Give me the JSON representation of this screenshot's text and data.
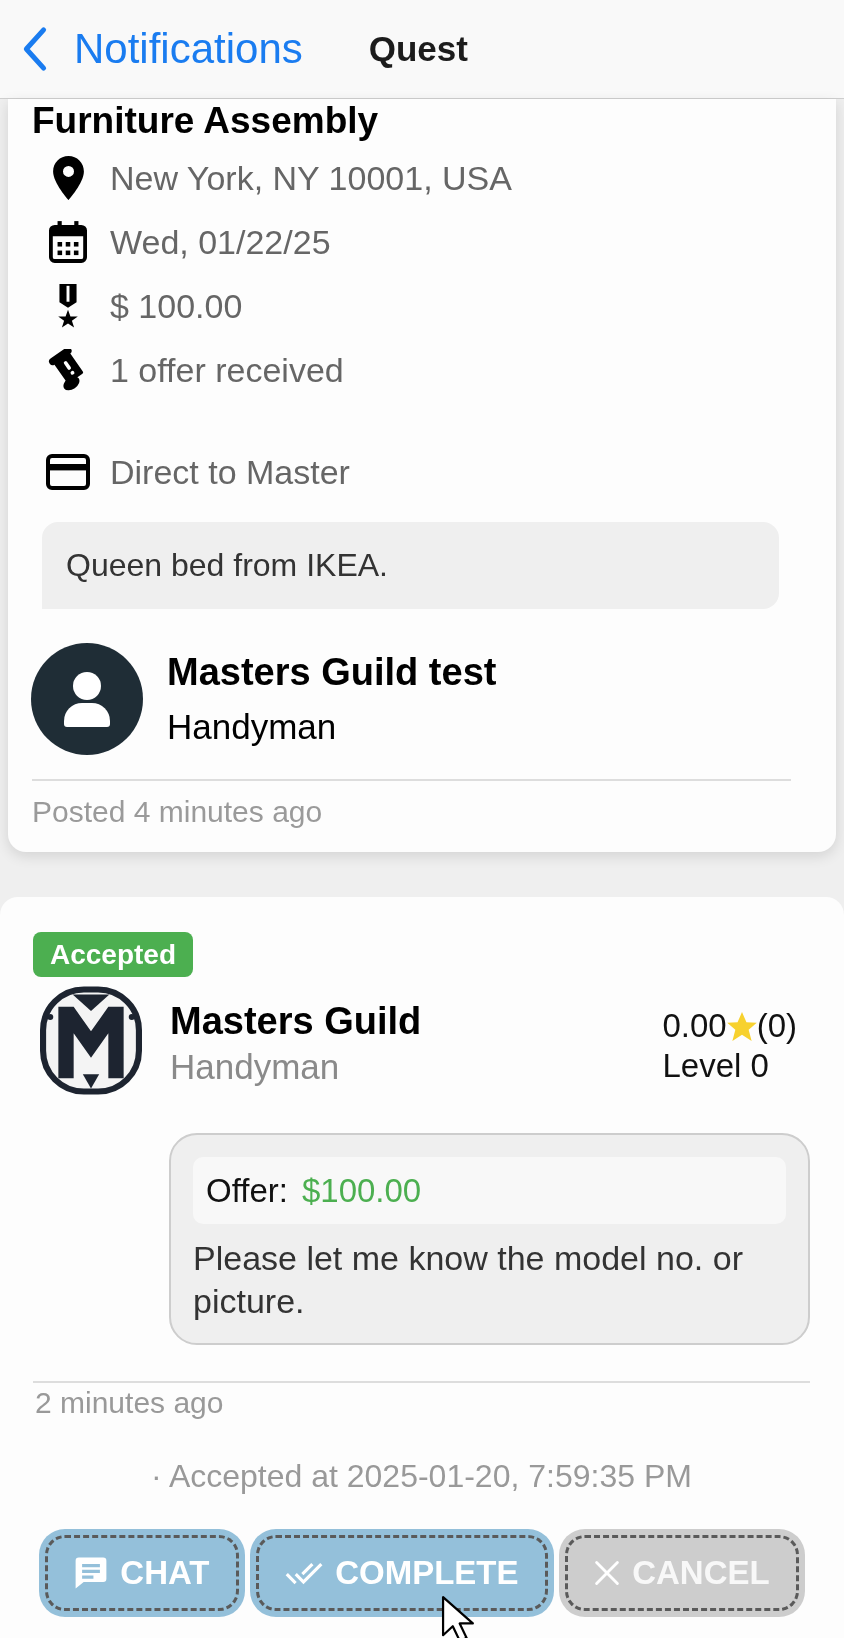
{
  "nav": {
    "back_label": "Notifications",
    "title": "Quest"
  },
  "quest": {
    "title": "Furniture Assembly",
    "details": [
      {
        "kind": "location",
        "text": "New York, NY 10001, USA"
      },
      {
        "kind": "date",
        "text": "Wed, 01/22/25"
      },
      {
        "kind": "reward",
        "text": "$ 100.00"
      },
      {
        "kind": "offers",
        "text": "1 offer received"
      }
    ],
    "payment": "Direct to Master",
    "description": "Queen bed from IKEA.",
    "poster": {
      "name": "Masters Guild test",
      "trade": "Handyman"
    },
    "posted": "Posted 4 minutes ago"
  },
  "offer": {
    "status": "Accepted",
    "provider": {
      "name": "Masters Guild",
      "trade": "Handyman",
      "rating": "0.00",
      "review_count": "(0)",
      "level": "Level 0"
    },
    "offer_label": "Offer:",
    "amount": "$100.00",
    "message": "Please let me know the model no. or picture.",
    "time": "2 minutes ago",
    "accepted_at": "· Accepted at 2025-01-20, 7:59:35 PM"
  },
  "actions": [
    {
      "kind": "chat",
      "label": "CHAT",
      "disabled": false
    },
    {
      "kind": "complete",
      "label": "COMPLETE",
      "disabled": false
    },
    {
      "kind": "cancel",
      "label": "CANCEL",
      "disabled": true
    }
  ]
}
